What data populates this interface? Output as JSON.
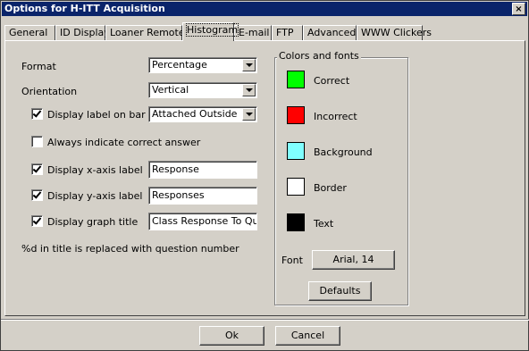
{
  "window": {
    "title": "Options for H-ITT Acquisition",
    "close_glyph": "×"
  },
  "tabs": [
    {
      "label": "General"
    },
    {
      "label": "ID Display"
    },
    {
      "label": "Loaner Remotes"
    },
    {
      "label": "Histogram"
    },
    {
      "label": "E-mail"
    },
    {
      "label": "FTP"
    },
    {
      "label": "Advanced"
    },
    {
      "label": "WWW Clickers"
    }
  ],
  "active_tab": "Histogram",
  "form": {
    "format": {
      "label": "Format",
      "value": "Percentage"
    },
    "orientation": {
      "label": "Orientation",
      "value": "Vertical"
    },
    "label_on_bar": {
      "label": "Display label on bar",
      "checked": true,
      "value": "Attached Outside"
    },
    "always_correct": {
      "label": "Always indicate correct answer",
      "checked": false
    },
    "x_axis": {
      "label": "Display x-axis label",
      "checked": true,
      "value": "Response"
    },
    "y_axis": {
      "label": "Display y-axis label",
      "checked": true,
      "value": "Responses"
    },
    "graph_title": {
      "label": "Display graph title",
      "checked": true,
      "value": "Class Response To Questi"
    },
    "note": "%d in title is replaced with question number"
  },
  "colors": {
    "group_title": "Colors and fonts",
    "items": [
      {
        "label": "Correct",
        "color": "#00ff00"
      },
      {
        "label": "Incorrect",
        "color": "#ff0000"
      },
      {
        "label": "Background",
        "color": "#80ffff"
      },
      {
        "label": "Border",
        "color": "#ffffff"
      },
      {
        "label": "Text",
        "color": "#000000"
      }
    ],
    "font_label": "Font",
    "font_value": "Arial, 14",
    "defaults_label": "Defaults"
  },
  "footer": {
    "ok_label": "Ok",
    "cancel_label": "Cancel"
  }
}
